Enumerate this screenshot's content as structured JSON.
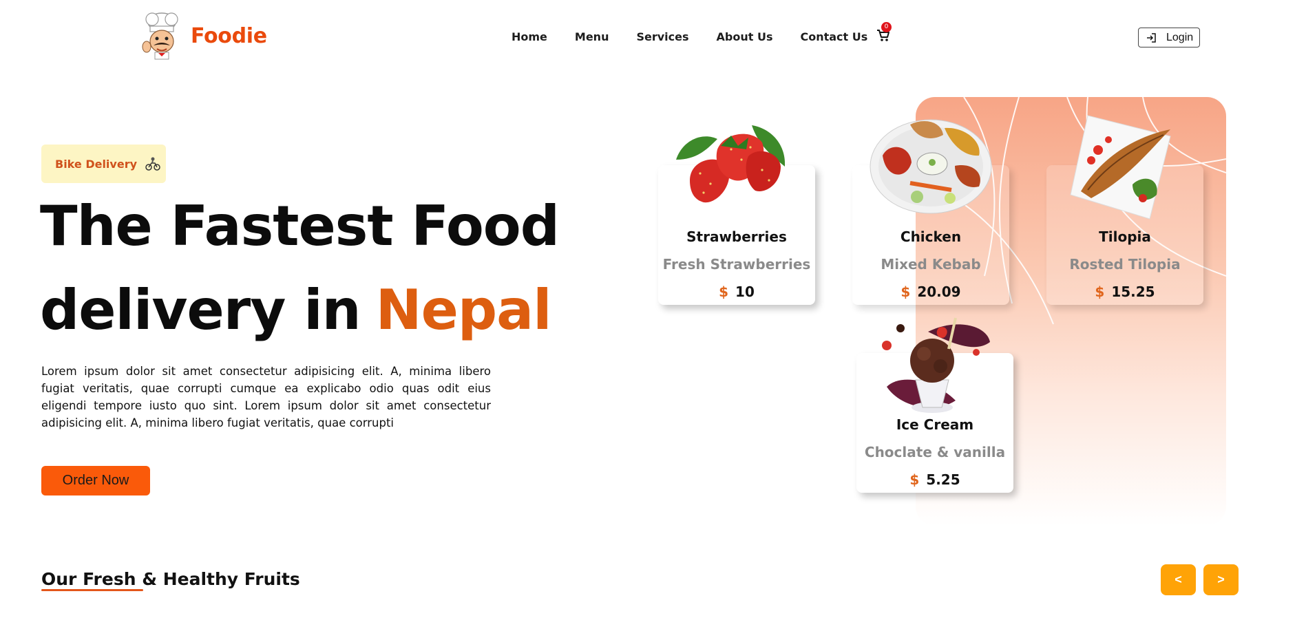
{
  "header": {
    "logo_text": "Foodie",
    "nav": [
      "Home",
      "Menu",
      "Services",
      "About Us",
      "Contact Us"
    ],
    "cart_count": "0",
    "login_label": "Login"
  },
  "hero": {
    "badge": "Bike Delivery",
    "headline_line1": "The Fastest Food",
    "headline_line2": "delivery in",
    "headline_accent": "Nepal",
    "description": "Lorem ipsum dolor sit amet consectetur adipisicing elit. A, minima libero fugiat veritatis, quae corrupti cumque ea explicabo odio quas odit eius eligendi tempore iusto quo sint. Lorem ipsum dolor sit amet consectetur adipisicing elit. A, minima libero fugiat veritatis, quae corrupti",
    "order_button": "Order Now"
  },
  "cards": [
    {
      "name": "Strawberries",
      "subtitle": "Fresh Strawberries",
      "currency": "$",
      "price": "10",
      "image_icon": "strawberry-icon"
    },
    {
      "name": "Chicken",
      "subtitle": "Mixed Kebab",
      "currency": "$",
      "price": "20.09",
      "image_icon": "kebab-platter-icon"
    },
    {
      "name": "Tilopia",
      "subtitle": "Rosted Tilopia",
      "currency": "$",
      "price": "15.25",
      "image_icon": "fish-dish-icon"
    },
    {
      "name": "Ice Cream",
      "subtitle": "Choclate & vanilla",
      "currency": "$",
      "price": "5.25",
      "image_icon": "ice-cream-icon"
    }
  ],
  "section": {
    "title": "Our Fresh & Healthy Fruits",
    "prev_label": "<",
    "next_label": ">"
  },
  "colors": {
    "accent": "#dd5e10",
    "order_button": "#fa5a0a",
    "nav_buttons": "#ffa307",
    "badge_bg": "#fdf5c4"
  }
}
